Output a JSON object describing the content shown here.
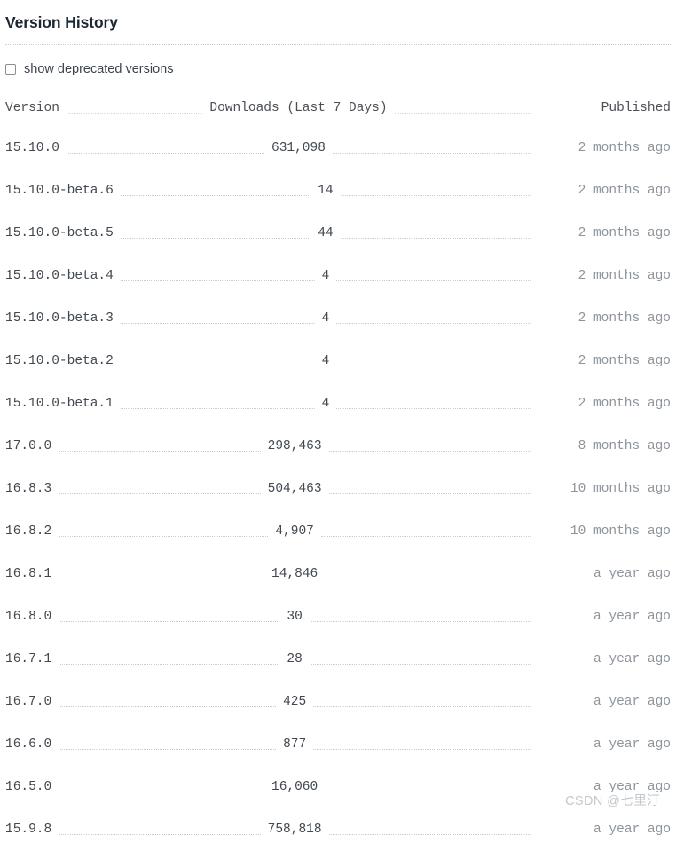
{
  "header": {
    "title": "Version History"
  },
  "filter": {
    "checkbox_label": "show deprecated versions",
    "checked": false
  },
  "table": {
    "columns": {
      "version": "Version",
      "downloads": "Downloads (Last 7 Days)",
      "published": "Published"
    },
    "rows": [
      {
        "version": "15.10.0",
        "downloads": "631,098",
        "published": "2 months ago"
      },
      {
        "version": "15.10.0-beta.6",
        "downloads": "14",
        "published": "2 months ago"
      },
      {
        "version": "15.10.0-beta.5",
        "downloads": "44",
        "published": "2 months ago"
      },
      {
        "version": "15.10.0-beta.4",
        "downloads": "4",
        "published": "2 months ago"
      },
      {
        "version": "15.10.0-beta.3",
        "downloads": "4",
        "published": "2 months ago"
      },
      {
        "version": "15.10.0-beta.2",
        "downloads": "4",
        "published": "2 months ago"
      },
      {
        "version": "15.10.0-beta.1",
        "downloads": "4",
        "published": "2 months ago"
      },
      {
        "version": "17.0.0",
        "downloads": "298,463",
        "published": "8 months ago"
      },
      {
        "version": "16.8.3",
        "downloads": "504,463",
        "published": "10 months ago"
      },
      {
        "version": "16.8.2",
        "downloads": "4,907",
        "published": "10 months ago"
      },
      {
        "version": "16.8.1",
        "downloads": "14,846",
        "published": "a year ago"
      },
      {
        "version": "16.8.0",
        "downloads": "30",
        "published": "a year ago"
      },
      {
        "version": "16.7.1",
        "downloads": "28",
        "published": "a year ago"
      },
      {
        "version": "16.7.0",
        "downloads": "425",
        "published": "a year ago"
      },
      {
        "version": "16.6.0",
        "downloads": "877",
        "published": "a year ago"
      },
      {
        "version": "16.5.0",
        "downloads": "16,060",
        "published": "a year ago"
      },
      {
        "version": "15.9.8",
        "downloads": "758,818",
        "published": "a year ago"
      }
    ]
  },
  "watermark": {
    "text": "CSDN @七里汀"
  },
  "colors": {
    "title": "#1c2733",
    "body_text": "#41484f",
    "muted_text": "#8d949b",
    "leader_dots": "#c9cdd1",
    "divider": "#cccccc",
    "background": "#ffffff",
    "watermark": "#c4c8cc"
  }
}
